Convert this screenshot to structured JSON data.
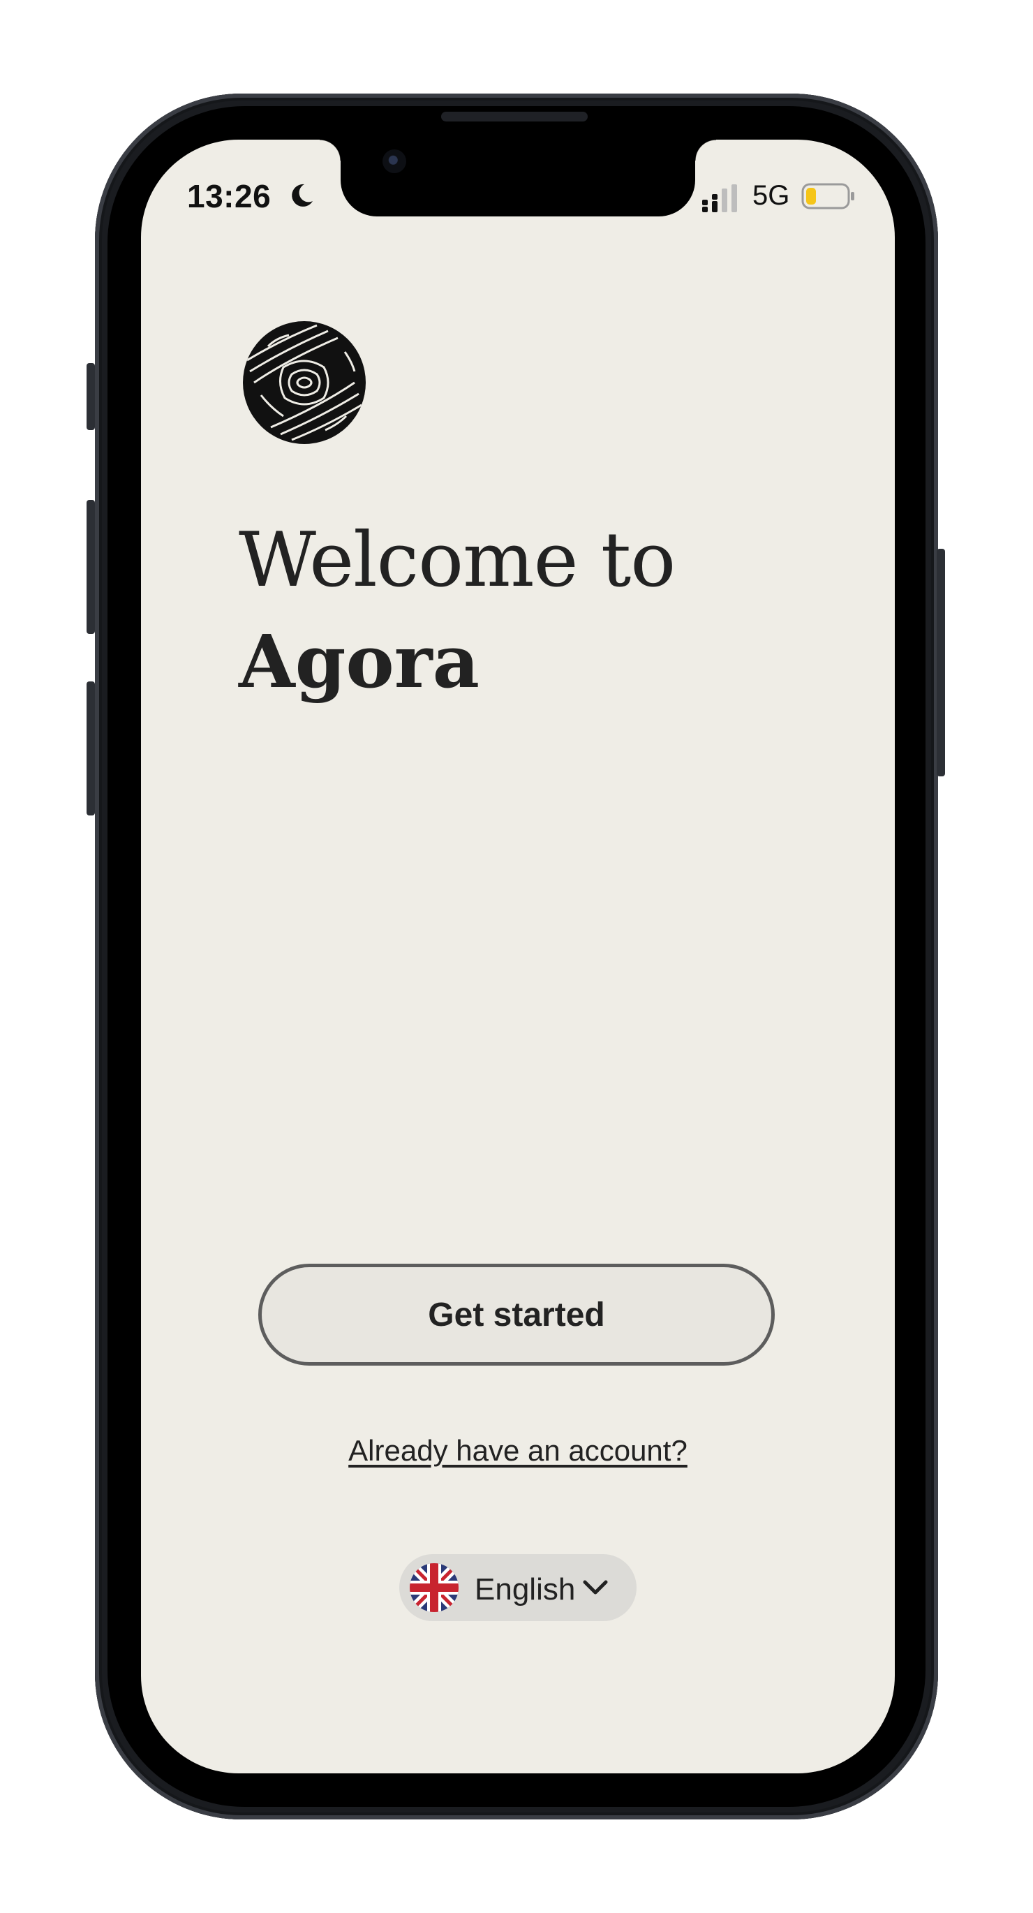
{
  "status_bar": {
    "time": "13:26",
    "network": "5G",
    "icons": [
      "moon-icon",
      "signal-icon",
      "battery-icon"
    ]
  },
  "welcome": {
    "line1": "Welcome to",
    "line2": "Agora"
  },
  "actions": {
    "get_started_label": "Get started",
    "login_link": "Already have an account?"
  },
  "language": {
    "selected": "English",
    "flag_icon": "uk-flag-icon",
    "chevron_icon": "chevron-down-icon"
  },
  "colors": {
    "background": "#efede6",
    "text": "#222222",
    "button_border": "#5d5d5d",
    "pill": "#dcdbd7",
    "battery_fill": "#f5c518"
  }
}
